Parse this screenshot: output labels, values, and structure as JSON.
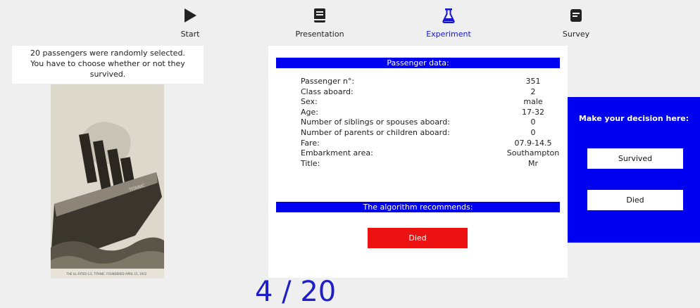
{
  "nav": {
    "items": [
      {
        "label": "Start",
        "icon": "play-icon"
      },
      {
        "label": "Presentation",
        "icon": "book-icon"
      },
      {
        "label": "Experiment",
        "icon": "flask-icon",
        "active": true
      },
      {
        "label": "Survey",
        "icon": "list-icon"
      }
    ]
  },
  "intro": {
    "text_line1": "20 passengers were randomly selected.",
    "text_line2": "You have to choose whether or not they",
    "text_line3": "survived."
  },
  "photo": {
    "caption": "THE ILL-FATED S.S. TITANIC. FOUNDERED APRIL 15, 1912.",
    "ship_name": "TITANIC"
  },
  "passenger": {
    "header": "Passenger data:",
    "fields": [
      {
        "label": "Passenger n°:",
        "value": "351"
      },
      {
        "label": "Class aboard:",
        "value": "2"
      },
      {
        "label": "Sex:",
        "value": "male"
      },
      {
        "label": "Age:",
        "value": "17-32"
      },
      {
        "label": "Number of siblings or spouses aboard:",
        "value": "0"
      },
      {
        "label": "Number of parents or children aboard:",
        "value": "0"
      },
      {
        "label": "Fare:",
        "value": "07.9-14.5"
      },
      {
        "label": "Embarkment area:",
        "value": "Southampton"
      },
      {
        "label": "Title:",
        "value": "Mr"
      }
    ]
  },
  "algorithm": {
    "header": "The algorithm recommends:",
    "recommendation": "Died"
  },
  "decision": {
    "title": "Make your decision here:",
    "survived_label": "Survived",
    "died_label": "Died"
  },
  "progress": {
    "text": "4 / 20",
    "current": 4,
    "total": 20
  },
  "colors": {
    "accent_blue": "#0000f0",
    "recommend_red": "#ec1212",
    "active_nav": "#1414d6"
  }
}
